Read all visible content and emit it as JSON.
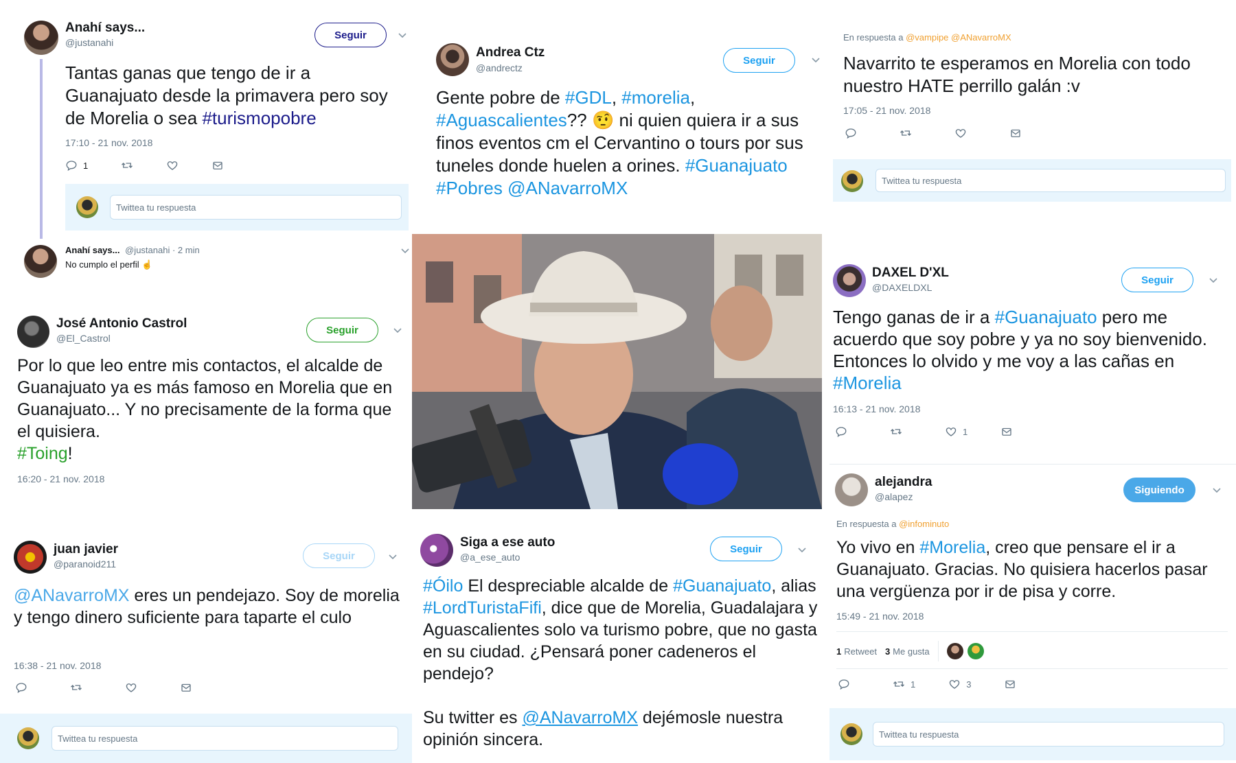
{
  "tweets": {
    "anahi": {
      "name": "Anahí says...",
      "handle": "@justanahi",
      "follow": "Seguir",
      "text_pre": "Tantas ganas que tengo de ir a Guanajuato desde la primavera pero soy de Morelia o sea ",
      "hashtag1": "#turismopobre",
      "time": "17:10 - 21 nov. 2018",
      "reply_count": "1",
      "reply_placeholder": "Twittea tu respuesta",
      "thread_name": "Anahí says...",
      "thread_handle": "@justanahi · 2 min",
      "thread_text": "No cumplo el perfil ☝️"
    },
    "jose": {
      "name": "José Antonio Castrol",
      "handle": "@El_Castrol",
      "follow": "Seguir",
      "text": "Por lo que leo entre mis contactos, el alcalde de Guanajuato ya es más famoso en Morelia que en Guanajuato... Y no precisamente de la forma que el quisiera.",
      "hashtag": "#Toing",
      "after": "!",
      "time": "16:20 - 21 nov. 2018"
    },
    "juan": {
      "name": "juan javier",
      "handle": "@paranoid211",
      "follow": "Seguir",
      "mention": "@ANavarroMX",
      "text": " eres un pendejazo. Soy de morelia y tengo dinero suficiente para taparte el culo",
      "time": "16:38 - 21 nov. 2018",
      "reply_placeholder": "Twittea tu respuesta"
    },
    "andrea": {
      "name": "Andrea Ctz",
      "handle": "@andrectz",
      "follow": "Seguir",
      "t1": "Gente pobre de ",
      "h1": "#GDL",
      "t2": ", ",
      "h2": "#morelia",
      "t3": ", ",
      "h3": "#Aguascalientes",
      "t4": "?? 🤨 ni quien quiera ir a sus finos eventos cm el Cervantino o tours por sus tuneles donde huelen a orines. ",
      "h4": "#Guanajuato",
      "t5": " ",
      "h5": "#Pobres",
      "t6": " ",
      "h6": "@ANavarroMX"
    },
    "siga": {
      "name": "Siga a ese auto",
      "handle": "@a_ese_auto",
      "follow": "Seguir",
      "h1": "#Óilo",
      "t1": " El despreciable alcalde de ",
      "h2": "#Guanajuato",
      "t2": ", alias ",
      "h3": "#LordTuristaFifi",
      "t3": ", dice que de Morelia, Guadalajara y Aguascalientes solo va turismo pobre, que no gasta en su ciudad. ¿Pensará poner cadeneros el pendejo?",
      "t4": "Su twitter es ",
      "m1": "@ANavarroMX",
      "t5": " dejémosle nuestra opinión sincera."
    },
    "navarrito": {
      "reply_to_label": "En respuesta a",
      "reply_to": "@vampipe @ANavarroMX",
      "text": "Navarrito te esperamos en Morelia con todo nuestro HATE  perrillo galán :v",
      "time": "17:05 - 21 nov. 2018",
      "reply_placeholder": "Twittea tu respuesta"
    },
    "daxel": {
      "name": "DAXEL D'XL",
      "handle": "@DAXELDXL",
      "follow": "Seguir",
      "t1": "Tengo ganas de ir a ",
      "h1": "#Guanajuato",
      "t2": " pero me acuerdo que soy pobre y ya no soy bienvenido. Entonces lo olvido y me voy a las cañas en ",
      "h2": "#Morelia",
      "time": "16:13 - 21 nov. 2018",
      "like_count": "1"
    },
    "alejandra": {
      "name": "alejandra",
      "handle": "@alapez",
      "follow": "Siguiendo",
      "reply_to_label": "En respuesta a",
      "reply_to": "@infominuto",
      "t1": "Yo vivo en ",
      "h1": "#Morelia",
      "t2": ", creo que pensare el ir a Guanajuato. Gracias. No quisiera hacerlos pasar una vergüenza por ir de pisa y corre.",
      "time": "15:49 - 21 nov. 2018",
      "retweets_num": "1",
      "retweets_label": "Retweet",
      "likes_num": "3",
      "likes_label": "Me gusta",
      "rt_count": "1",
      "like_count": "3",
      "reply_placeholder": "Twittea tu respuesta"
    }
  },
  "colors": {
    "hashtag": "#1b95e0",
    "secondary": "#657786",
    "follow_blue": "#1da1f2",
    "follow_dark": "#1b1b8a",
    "follow_green": "#28a02a",
    "reply_box_bg": "#e8f5fd"
  },
  "icons": [
    "reply-icon",
    "retweet-icon",
    "like-icon",
    "dm-icon",
    "chevron-down-icon"
  ]
}
